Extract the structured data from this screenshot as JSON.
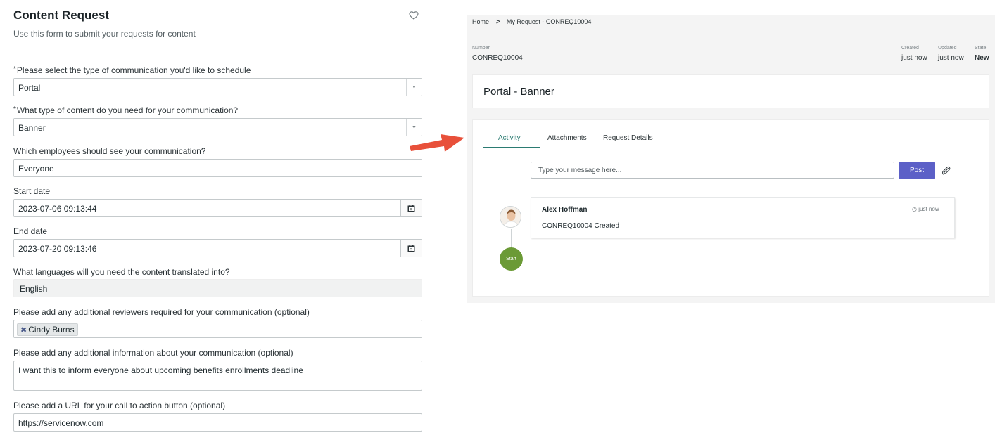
{
  "form": {
    "title": "Content Request",
    "subtitle": "Use this form to submit your requests for content",
    "fields": {
      "comm_type": {
        "label": "Please select the type of communication you'd like to schedule",
        "required": "*",
        "value": "Portal"
      },
      "content_type": {
        "label": "What type of content do you need for your communication?",
        "required": "*",
        "value": "Banner"
      },
      "audience": {
        "label": "Which employees should see your communication?",
        "value": "Everyone"
      },
      "start_date": {
        "label": "Start date",
        "value": "2023-07-06 09:13:44"
      },
      "end_date": {
        "label": "End date",
        "value": "2023-07-20 09:13:46"
      },
      "languages": {
        "label": "What languages will you need the content translated into?",
        "value": "English"
      },
      "reviewers": {
        "label": "Please add any additional reviewers required for your communication (optional)",
        "chips": [
          "Cindy Burns"
        ]
      },
      "additional_info": {
        "label": "Please add any additional information about your communication (optional)",
        "value": "I want this to inform everyone about upcoming benefits enrollments deadline"
      },
      "cta_url": {
        "label": "Please add a URL for your call to action button (optional)",
        "value": "https://servicenow.com"
      }
    }
  },
  "record": {
    "breadcrumb": [
      "Home",
      "My Request - CONREQ10004"
    ],
    "number_label": "Number",
    "number": "CONREQ10004",
    "created_label": "Created",
    "created": "just now",
    "updated_label": "Updated",
    "updated": "just now",
    "state_label": "State",
    "state": "New",
    "title": "Portal - Banner",
    "tabs": [
      "Activity",
      "Attachments",
      "Request Details"
    ],
    "message_placeholder": "Type your message here...",
    "post_label": "Post",
    "activity": {
      "author": "Alex Hoffman",
      "time": "just now",
      "body": "CONREQ10004 Created",
      "start_label": "Start"
    }
  },
  "colors": {
    "active_tab": "#2b7b72",
    "post_button": "#5c60c7",
    "start_node": "#6b9a36",
    "annotation_arrow": "#e8503a"
  }
}
